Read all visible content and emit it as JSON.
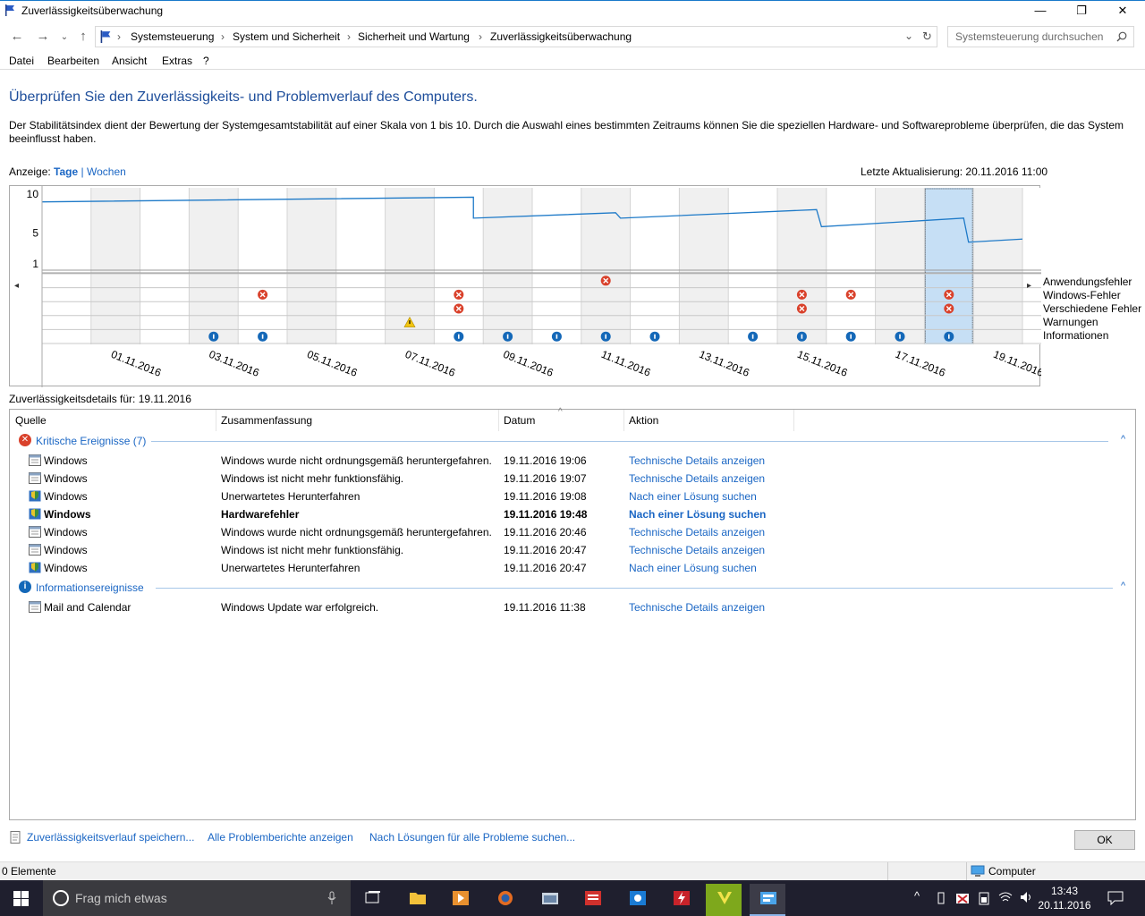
{
  "window": {
    "title": "Zuverlässigkeitsüberwachung",
    "minimize_glyph": "—",
    "maximize_glyph": "❐",
    "close_glyph": "✕"
  },
  "address": {
    "crumbs": [
      "Systemsteuerung",
      "System und Sicherheit",
      "Sicherheit und Wartung",
      "Zuverlässigkeitsüberwachung"
    ],
    "separator": "›",
    "search_placeholder": "Systemsteuerung durchsuchen"
  },
  "menu": [
    "Datei",
    "Bearbeiten",
    "Ansicht",
    "Extras",
    "?"
  ],
  "heading": "Überprüfen Sie den Zuverlässigkeits- und Problemverlauf des Computers.",
  "description": "Der Stabilitätsindex dient der Bewertung der Systemgesamtstabilität auf einer Skala von 1 bis 10. Durch die Auswahl eines bestimmten Zeitraums können Sie die speziellen Hardware- und Softwareprobleme überprüfen, die das System beeinflusst haben.",
  "view": {
    "label": "Anzeige:",
    "days": "Tage",
    "sep": "|",
    "weeks": "Wochen"
  },
  "last_update": "Letzte Aktualisierung: 20.11.2016 11:00",
  "chart_data": {
    "type": "line",
    "y_ticks": [
      "10",
      "5",
      "1"
    ],
    "ylim": [
      1,
      10
    ],
    "x_tick_labels": [
      "01.11.2016",
      "03.11.2016",
      "05.11.2016",
      "07.11.2016",
      "09.11.2016",
      "11.11.2016",
      "13.11.2016",
      "15.11.2016",
      "17.11.2016",
      "19.11.2016"
    ],
    "days": [
      "31.10.2016",
      "01.11.2016",
      "02.11.2016",
      "03.11.2016",
      "04.11.2016",
      "05.11.2016",
      "06.11.2016",
      "07.11.2016",
      "08.11.2016",
      "09.11.2016",
      "10.11.2016",
      "11.11.2016",
      "12.11.2016",
      "13.11.2016",
      "14.11.2016",
      "15.11.2016",
      "16.11.2016",
      "17.11.2016",
      "18.11.2016",
      "19.11.2016",
      "20.11.2016"
    ],
    "stability_series": [
      {
        "x": 0,
        "y": 9.0
      },
      {
        "x": 8.8,
        "y": 9.6
      },
      {
        "x": 8.8,
        "y": 6.9
      },
      {
        "x": 11.7,
        "y": 7.6
      },
      {
        "x": 11.8,
        "y": 6.9
      },
      {
        "x": 15.8,
        "y": 8.0
      },
      {
        "x": 15.9,
        "y": 5.8
      },
      {
        "x": 18.8,
        "y": 6.9
      },
      {
        "x": 18.9,
        "y": 3.8
      },
      {
        "x": 20.0,
        "y": 4.2
      }
    ],
    "event_rows": [
      "Anwendungsfehler",
      "Windows-Fehler",
      "Verschiedene Fehler",
      "Warnungen",
      "Informationen"
    ],
    "events": [
      {
        "day": 11,
        "row": 0,
        "kind": "error"
      },
      {
        "day": 4,
        "row": 1,
        "kind": "error"
      },
      {
        "day": 8,
        "row": 1,
        "kind": "error"
      },
      {
        "day": 15,
        "row": 1,
        "kind": "error"
      },
      {
        "day": 16,
        "row": 1,
        "kind": "error"
      },
      {
        "day": 18,
        "row": 1,
        "kind": "error"
      },
      {
        "day": 8,
        "row": 2,
        "kind": "error"
      },
      {
        "day": 15,
        "row": 2,
        "kind": "error"
      },
      {
        "day": 18,
        "row": 2,
        "kind": "error"
      },
      {
        "day": 7,
        "row": 3,
        "kind": "warning"
      },
      {
        "day": 3,
        "row": 4,
        "kind": "info"
      },
      {
        "day": 4,
        "row": 4,
        "kind": "info"
      },
      {
        "day": 8,
        "row": 4,
        "kind": "info"
      },
      {
        "day": 9,
        "row": 4,
        "kind": "info"
      },
      {
        "day": 10,
        "row": 4,
        "kind": "info"
      },
      {
        "day": 11,
        "row": 4,
        "kind": "info"
      },
      {
        "day": 12,
        "row": 4,
        "kind": "info"
      },
      {
        "day": 14,
        "row": 4,
        "kind": "info"
      },
      {
        "day": 15,
        "row": 4,
        "kind": "info"
      },
      {
        "day": 16,
        "row": 4,
        "kind": "info"
      },
      {
        "day": 17,
        "row": 4,
        "kind": "info"
      },
      {
        "day": 18,
        "row": 4,
        "kind": "info"
      }
    ],
    "selected_day": 18,
    "colors": {
      "line": "#1e7ac8",
      "error": "#d9412b",
      "warning": "#f2c511",
      "info": "#1468b8",
      "shade": "#f0f0f0",
      "selected": "#c6dff5"
    }
  },
  "details_for": "Zuverlässigkeitsdetails für: 19.11.2016",
  "table": {
    "columns": [
      "Quelle",
      "Zusammenfassung",
      "Datum",
      "Aktion"
    ],
    "sort_glyph": "^",
    "groups": [
      {
        "title": "Kritische Ereignisse (7)",
        "icon": "error-icon",
        "rows": [
          {
            "source": "Windows",
            "summary": "Windows wurde nicht ordnungsgemäß heruntergefahren.",
            "date": "19.11.2016 19:06",
            "action": "Technische Details anzeigen",
            "icon": "window-icon",
            "bold": false
          },
          {
            "source": "Windows",
            "summary": "Windows ist nicht mehr funktionsfähig.",
            "date": "19.11.2016 19:07",
            "action": "Technische Details anzeigen",
            "icon": "window-icon",
            "bold": false
          },
          {
            "source": "Windows",
            "summary": "Unerwartetes Herunterfahren",
            "date": "19.11.2016 19:08",
            "action": "Nach einer Lösung suchen",
            "icon": "shield-icon",
            "bold": false
          },
          {
            "source": "Windows",
            "summary": "Hardwarefehler",
            "date": "19.11.2016 19:48",
            "action": "Nach einer Lösung suchen",
            "icon": "shield-icon",
            "bold": true
          },
          {
            "source": "Windows",
            "summary": "Windows wurde nicht ordnungsgemäß heruntergefahren.",
            "date": "19.11.2016 20:46",
            "action": "Technische Details anzeigen",
            "icon": "window-icon",
            "bold": false
          },
          {
            "source": "Windows",
            "summary": "Windows ist nicht mehr funktionsfähig.",
            "date": "19.11.2016 20:47",
            "action": "Technische Details anzeigen",
            "icon": "window-icon",
            "bold": false
          },
          {
            "source": "Windows",
            "summary": "Unerwartetes Herunterfahren",
            "date": "19.11.2016 20:47",
            "action": "Nach einer Lösung suchen",
            "icon": "shield-icon",
            "bold": false
          }
        ]
      },
      {
        "title": "Informationsereignisse",
        "icon": "info-icon",
        "rows": [
          {
            "source": "Mail and Calendar",
            "summary": "Windows Update war erfolgreich.",
            "date": "19.11.2016 11:38",
            "action": "Technische Details anzeigen",
            "icon": "window-icon",
            "bold": false
          }
        ]
      }
    ]
  },
  "bottom_links": [
    "Zuverlässigkeitsverlauf speichern...",
    "Alle Problemberichte anzeigen",
    "Nach Lösungen für alle Probleme suchen..."
  ],
  "ok_label": "OK",
  "status": {
    "elements": "0 Elemente",
    "zone": "Computer"
  },
  "taskbar": {
    "search_placeholder": "Frag mich etwas",
    "time": "13:43",
    "date": "20.11.2016"
  }
}
